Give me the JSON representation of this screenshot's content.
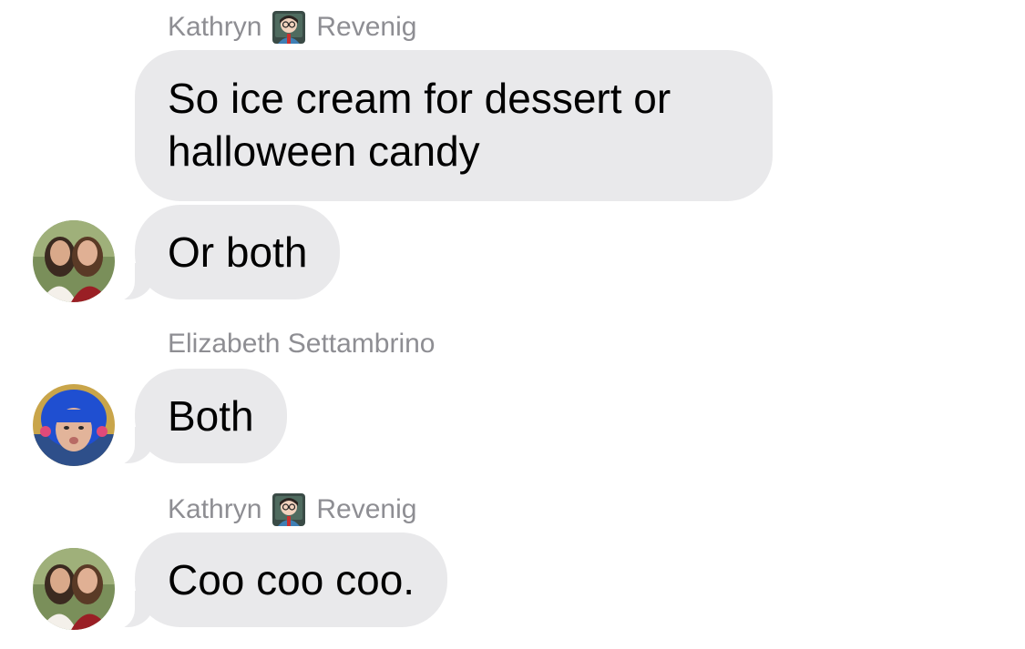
{
  "conversation": {
    "groups": [
      {
        "sender": {
          "first": "Kathryn",
          "last": "Revenig",
          "emoji": "teacher-emoji"
        },
        "messages": [
          "So ice cream for dessert or halloween candy",
          "Or both"
        ],
        "avatar": "two-women-photo"
      },
      {
        "sender": {
          "full": "Elizabeth Settambrino"
        },
        "messages": [
          "Both"
        ],
        "avatar": "blue-hair-photo"
      },
      {
        "sender": {
          "first": "Kathryn",
          "last": "Revenig",
          "emoji": "teacher-emoji"
        },
        "messages": [
          "Coo coo coo."
        ],
        "avatar": "two-women-photo"
      }
    ]
  },
  "colors": {
    "bubble_bg": "#e9e9eb",
    "sender_text": "#8e8e93",
    "message_text": "#000000"
  }
}
